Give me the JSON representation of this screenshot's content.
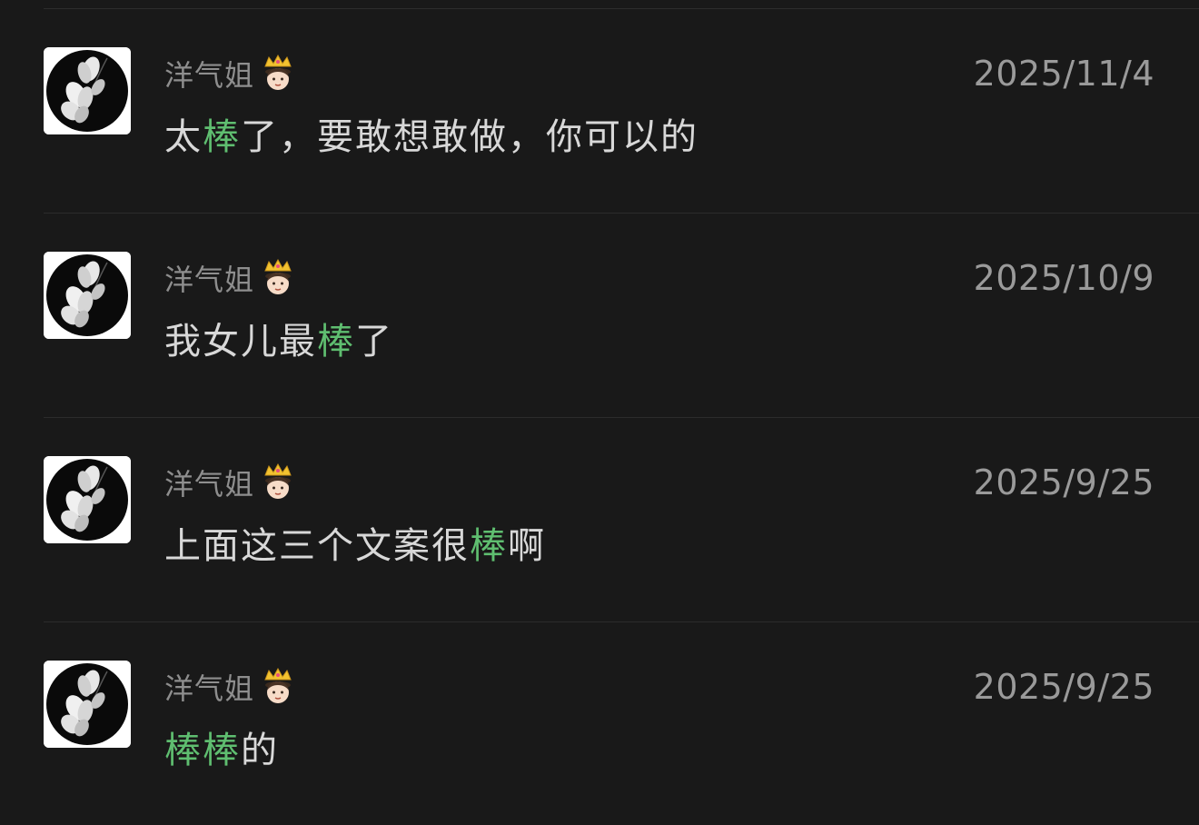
{
  "results": [
    {
      "sender": "洋气姐",
      "date": "2025/11/4",
      "message_parts": [
        {
          "text": "太",
          "highlight": false
        },
        {
          "text": "棒",
          "highlight": true
        },
        {
          "text": "了，要敢想敢做，你可以的",
          "highlight": false
        }
      ]
    },
    {
      "sender": "洋气姐",
      "date": "2025/10/9",
      "message_parts": [
        {
          "text": "我女儿最",
          "highlight": false
        },
        {
          "text": "棒",
          "highlight": true
        },
        {
          "text": "了",
          "highlight": false
        }
      ]
    },
    {
      "sender": "洋气姐",
      "date": "2025/9/25",
      "message_parts": [
        {
          "text": "上面这三个文案很",
          "highlight": false
        },
        {
          "text": "棒",
          "highlight": true
        },
        {
          "text": "啊",
          "highlight": false
        }
      ]
    },
    {
      "sender": "洋气姐",
      "date": "2025/9/25",
      "message_parts": [
        {
          "text": "棒棒",
          "highlight": true
        },
        {
          "text": "的",
          "highlight": false
        }
      ]
    }
  ],
  "icons": {
    "sender_badge": "princess-crown-emoji-icon",
    "avatar": "white-magnolia-avatar"
  },
  "colors": {
    "background": "#191919",
    "highlight": "#5fbe70",
    "divider": "#2c2c2c"
  }
}
